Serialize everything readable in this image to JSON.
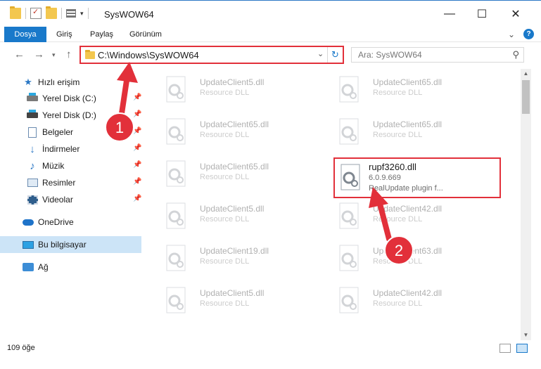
{
  "window": {
    "title": "SysWOW64",
    "minimize": "—",
    "maximize": "☐",
    "close": "✕"
  },
  "ribbon": {
    "tabs": [
      "Dosya",
      "Giriş",
      "Paylaş",
      "Görünüm"
    ]
  },
  "address_bar": {
    "path": "C:\\Windows\\SysWOW64",
    "search_placeholder": "Ara: SysWOW64"
  },
  "sidebar": {
    "quick_access": "Hızlı erişim",
    "items": [
      {
        "label": "Yerel Disk (C:)",
        "icon": "drive-icon"
      },
      {
        "label": "Yerel Disk (D:)",
        "icon": "drive-icon"
      },
      {
        "label": "Belgeler",
        "icon": "documents-icon"
      },
      {
        "label": "İndirmeler",
        "icon": "downloads-icon"
      },
      {
        "label": "Müzik",
        "icon": "music-icon"
      },
      {
        "label": "Resimler",
        "icon": "pictures-icon"
      },
      {
        "label": "Videolar",
        "icon": "videos-icon"
      }
    ],
    "onedrive": "OneDrive",
    "this_pc": "Bu bilgisayar",
    "network": "Ağ"
  },
  "files": {
    "left": [
      {
        "name": "UpdateClient5.dll",
        "type": "Resource DLL"
      },
      {
        "name": "UpdateClient65.dll",
        "type": "Resource DLL"
      },
      {
        "name": "UpdateClient65.dll",
        "type": "Resource DLL"
      },
      {
        "name": "UpdateClient5.dll",
        "type": "Resource DLL"
      },
      {
        "name": "UpdateClient19.dll",
        "type": "Resource DLL"
      },
      {
        "name": "UpdateClient5.dll",
        "type": "Resource DLL"
      }
    ],
    "right": [
      {
        "name": "UpdateClient65.dll",
        "type": "Resource DLL"
      },
      {
        "name": "UpdateClient65.dll",
        "type": "Resource DLL"
      },
      {
        "name": "UpdateClient42.dll",
        "type": "Resource DLL"
      },
      {
        "name": "UpdateClient63.dll",
        "type": "Resource DLL"
      },
      {
        "name": "UpdateClient42.dll",
        "type": "Resource DLL"
      }
    ],
    "selected": {
      "name": "rupf3260.dll",
      "version": "6.0.9.669",
      "description": "RealUpdate plugin f..."
    }
  },
  "status": {
    "item_count": "109 öğe"
  },
  "annotations": {
    "step1": "1",
    "step2": "2",
    "color": "#e2303a"
  }
}
